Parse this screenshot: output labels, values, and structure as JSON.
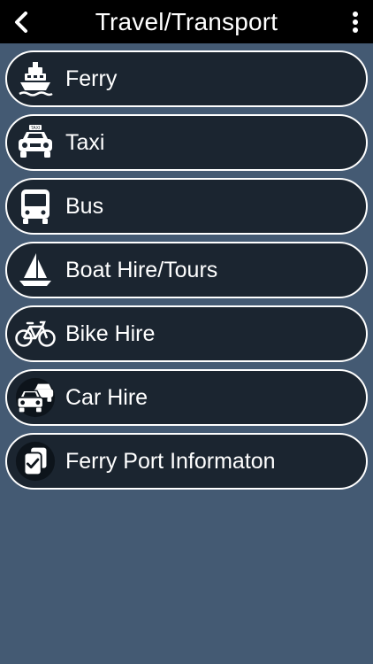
{
  "header": {
    "title": "Travel/Transport",
    "back_icon": "chevron-left-icon",
    "menu_icon": "more-vertical-icon"
  },
  "menu": {
    "items": [
      {
        "label": "Ferry",
        "icon": "ferry-icon"
      },
      {
        "label": "Taxi",
        "icon": "taxi-icon"
      },
      {
        "label": "Bus",
        "icon": "bus-icon"
      },
      {
        "label": "Boat Hire/Tours",
        "icon": "sailboat-icon"
      },
      {
        "label": "Bike Hire",
        "icon": "bicycle-icon"
      },
      {
        "label": "Car Hire",
        "icon": "cars-icon"
      },
      {
        "label": "Ferry Port Informaton",
        "icon": "checklist-document-icon"
      }
    ]
  },
  "colors": {
    "background": "#445a73",
    "topbar": "#000000",
    "item_background": "#1b2530",
    "item_border": "#ffffff",
    "text": "#ffffff"
  }
}
